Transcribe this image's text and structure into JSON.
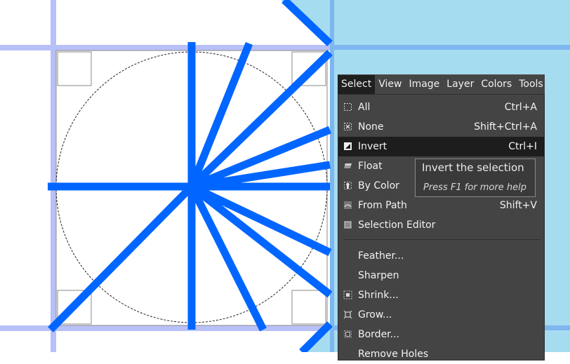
{
  "menubar": {
    "items": [
      "Select",
      "View",
      "Image",
      "Layer",
      "Colors",
      "Tools"
    ],
    "active": "Select"
  },
  "select_menu": {
    "items": [
      {
        "icon": "select-all-icon",
        "label": "All",
        "shortcut": "Ctrl+A"
      },
      {
        "icon": "select-none-icon",
        "label": "None",
        "shortcut": "Shift+Ctrl+A"
      },
      {
        "icon": "invert-selection-icon",
        "label": "Invert",
        "shortcut": "Ctrl+I",
        "highlighted": true
      },
      {
        "icon": "float-selection-icon",
        "label": "Float",
        "shortcut": ""
      },
      {
        "icon": "select-by-color-icon",
        "label": "By Color",
        "shortcut": ""
      },
      {
        "icon": "selection-from-path-icon",
        "label": "From Path",
        "shortcut": "Shift+V"
      },
      {
        "icon": "selection-editor-icon",
        "label": "Selection Editor",
        "shortcut": ""
      },
      {
        "icon": "",
        "label": "Feather...",
        "shortcut": ""
      },
      {
        "icon": "",
        "label": "Sharpen",
        "shortcut": ""
      },
      {
        "icon": "shrink-selection-icon",
        "label": "Shrink...",
        "shortcut": ""
      },
      {
        "icon": "grow-selection-icon",
        "label": "Grow...",
        "shortcut": ""
      },
      {
        "icon": "border-selection-icon",
        "label": "Border...",
        "shortcut": ""
      },
      {
        "icon": "",
        "label": "Remove Holes",
        "shortcut": ""
      }
    ]
  },
  "tooltip": {
    "title": "Invert the selection",
    "hint": "Press F1 for more help"
  },
  "colors": {
    "menu_bg": "#444444",
    "highlight_bg": "#1d1d1d",
    "guide_blue": "#0066ff",
    "layer_cyan": "#a6dcf0",
    "grid_lavender": "#b8c0f8"
  }
}
